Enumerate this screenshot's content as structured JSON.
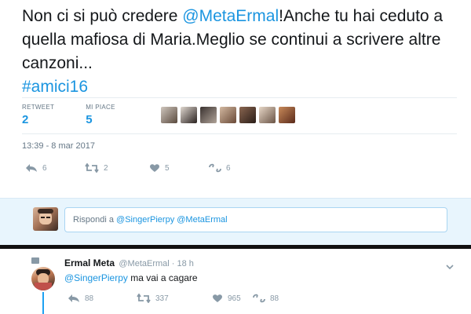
{
  "tweet": {
    "text_parts": {
      "p1": "Non ci si può credere ",
      "mention": "@MetaErmal",
      "p2": "!Anche tu hai ceduto a quella mafiosa di Maria.Meglio se continui a scrivere altre canzoni...",
      "hashtag": "#amici16"
    },
    "stats": {
      "retweet_label": "RETWEET",
      "retweet_count": "2",
      "likes_label": "MI PIACE",
      "likes_count": "5"
    },
    "timestamp": "13:39 - 8 mar 2017",
    "actions": {
      "reply": "6",
      "retweet": "2",
      "like": "5",
      "stats": "6"
    }
  },
  "reply_box": {
    "prefix": "Rispondi a ",
    "mentions": "@SingerPierpy @MetaErmal"
  },
  "reply_tweet": {
    "name": "Ermal Meta",
    "handle": "@MetaErmal · 18 h",
    "mention": "@SingerPierpy",
    "body": " ma vai a cagare",
    "actions": {
      "reply": "88",
      "retweet": "337",
      "like": "965",
      "stats": "88"
    }
  },
  "colors": {
    "accent": "#1b95e0",
    "muted": "#8899a6",
    "reply_bg": "#e8f5fd"
  },
  "icons": [
    "reply-icon",
    "retweet-icon",
    "heart-icon",
    "analytics-icon",
    "chevron-down-icon"
  ]
}
